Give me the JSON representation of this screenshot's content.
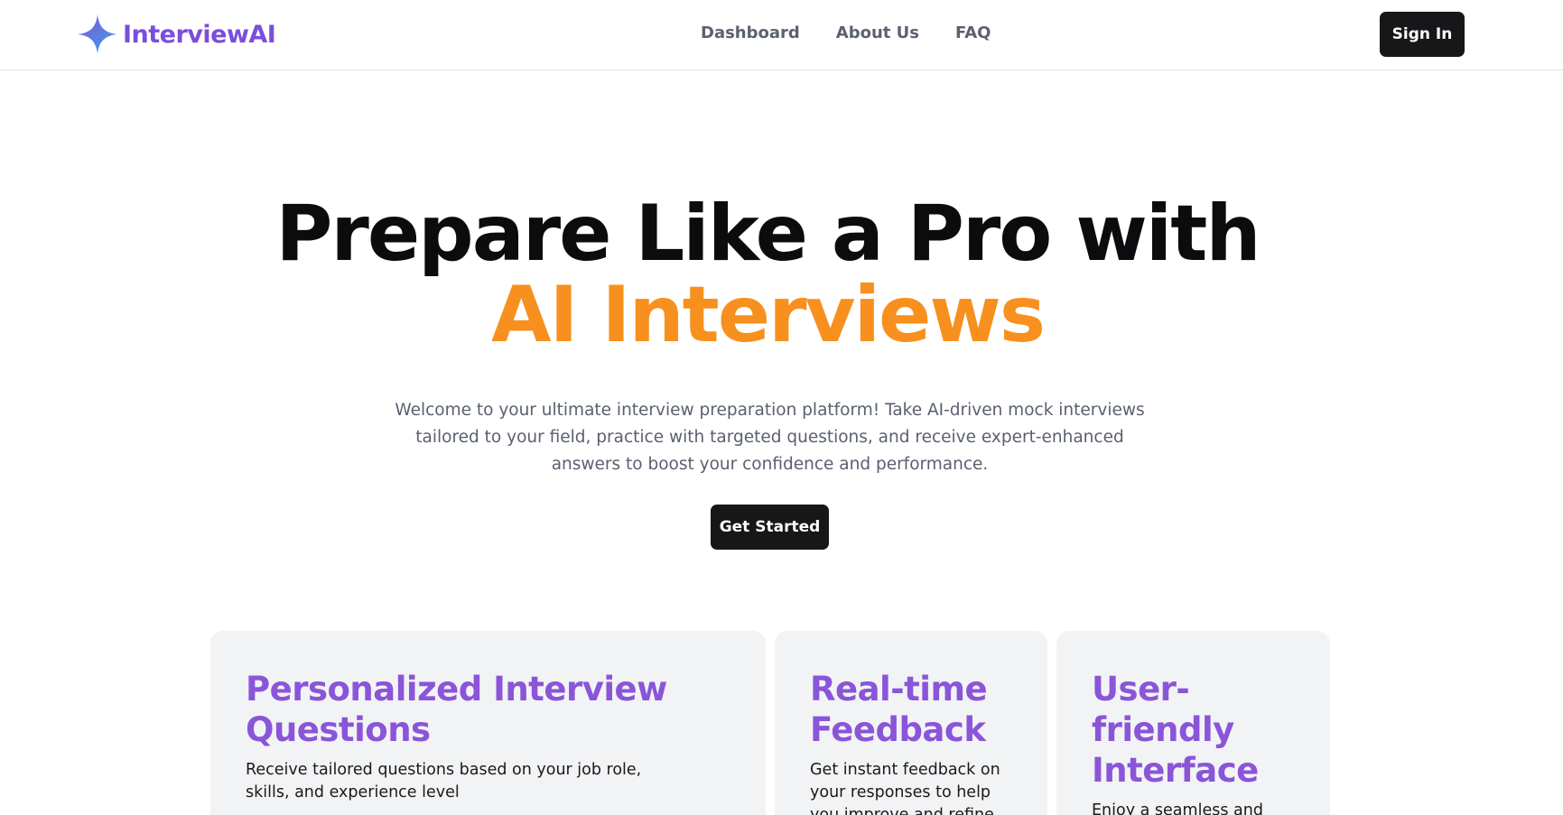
{
  "brand": {
    "name": "InterviewAI",
    "icon": "sparkle-star-icon",
    "color": "#7c4ddb"
  },
  "nav": {
    "links": [
      "Dashboard",
      "About Us",
      "FAQ"
    ],
    "signin_label": "Sign In"
  },
  "hero": {
    "title_line1": "Prepare Like a Pro with",
    "title_line2": "AI Interviews",
    "accent_color": "#f7901e",
    "subtitle": "Welcome to your ultimate interview preparation platform! Take AI-driven mock interviews tailored to your field, practice with targeted questions, and receive expert-enhanced answers to boost your confidence and performance.",
    "cta_label": "Get Started"
  },
  "features": [
    {
      "title": "Personalized Interview Questions",
      "description": "Receive tailored questions based on your job role, skills, and experience level"
    },
    {
      "title": "Real-time Feedback",
      "description": "Get instant feedback on your responses to help you improve and refine"
    },
    {
      "title": "User-friendly Interface",
      "description": "Enjoy a seamless and"
    }
  ]
}
